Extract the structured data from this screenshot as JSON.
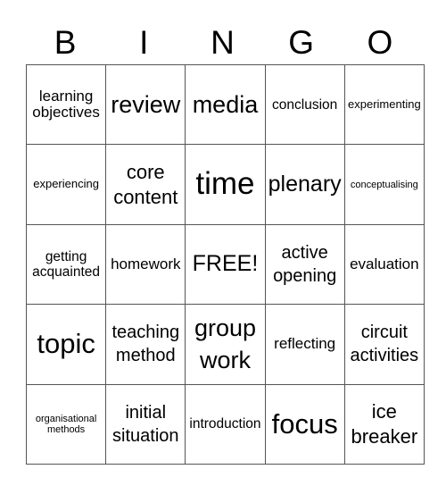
{
  "title_letters": [
    "B",
    "I",
    "N",
    "G",
    "O"
  ],
  "rows": [
    [
      "learning objectives",
      "review",
      "media",
      "conclusion",
      "experimenting"
    ],
    [
      "experiencing",
      "core content",
      "time",
      "plenary",
      "conceptualising"
    ],
    [
      "getting acquainted",
      "homework",
      "FREE!",
      "active opening",
      "evaluation"
    ],
    [
      "topic",
      "teaching method",
      "group work",
      "reflecting",
      "circuit activities"
    ],
    [
      "organisational methods",
      "initial situation",
      "introduction",
      "focus",
      "ice breaker"
    ]
  ],
  "free_space_label": "FREE!",
  "colors": {
    "grid_line": "#555555",
    "text": "#000000",
    "background": "#ffffff"
  }
}
